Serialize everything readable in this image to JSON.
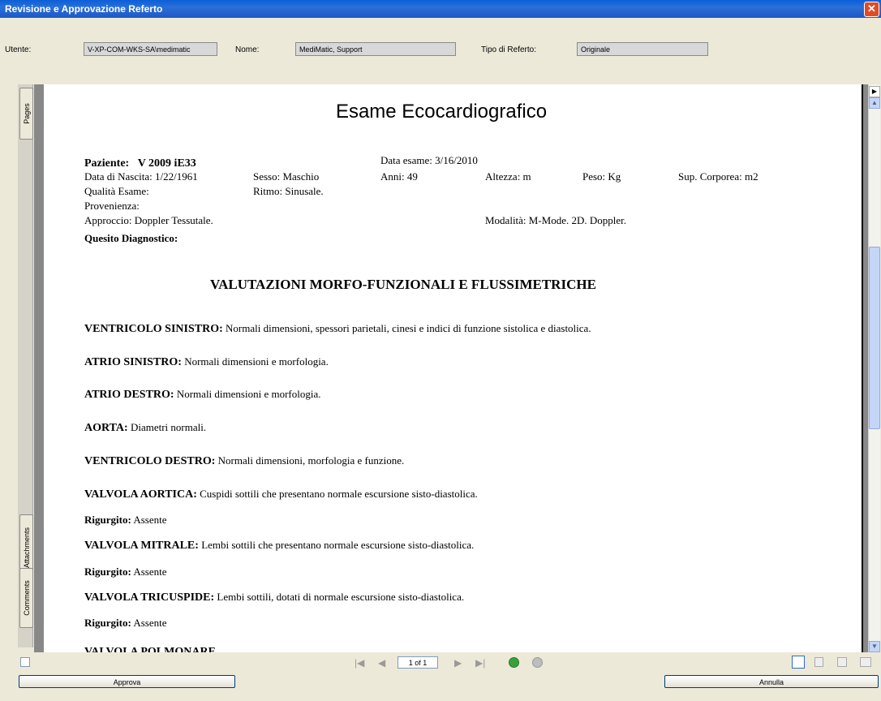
{
  "window": {
    "title": "Revisione e Approvazione Referto",
    "close_glyph": "✕"
  },
  "info": {
    "user_label": "Utente:",
    "user_value": "V-XP-COM-WKS-SA\\medimatic",
    "name_label": "Nome:",
    "name_value": "MediMatic, Support",
    "type_label": "Tipo di Referto:",
    "type_value": "Originale"
  },
  "side_tabs": {
    "pages": "Pages",
    "attachments": "Attachments",
    "comments": "Comments"
  },
  "report": {
    "title": "Esame Ecocardiografico",
    "patient_label": "Paziente:",
    "patient_value": "V 2009 iE33",
    "exam_date": "Data esame: 3/16/2010",
    "birth": "Data di Nascita: 1/22/1961",
    "sex": "Sesso: Maschio",
    "age": "Anni: 49",
    "height": "Altezza: m",
    "weight": "Peso: Kg",
    "bsa": "Sup. Corporea: m2",
    "quality": "Qualità Esame:",
    "rhythm": "Ritmo: Sinusale.",
    "origin": "Provenienza:",
    "approach": "Approccio: Doppler Tessutale.",
    "modality": "Modalità: M-Mode. 2D. Doppler.",
    "question": "Quesito Diagnostico:",
    "section_title": "VALUTAZIONI MORFO-FUNZIONALI E FLUSSIMETRICHE",
    "findings": [
      {
        "k": "VENTRICOLO SINISTRO:",
        "v": "Normali dimensioni, spessori parietali, cinesi e indici di funzione sistolica e diastolica."
      },
      {
        "k": "ATRIO SINISTRO:",
        "v": "Normali dimensioni e morfologia."
      },
      {
        "k": "ATRIO DESTRO:",
        "v": "Normali dimensioni e morfologia."
      },
      {
        "k": "AORTA:",
        "v": "Diametri normali."
      },
      {
        "k": "VENTRICOLO DESTRO:",
        "v": "Normali dimensioni, morfologia e funzione."
      },
      {
        "k": "VALVOLA AORTICA:",
        "v": "Cuspidi sottili che presentano normale escursione sisto-diastolica."
      },
      {
        "k": "Rigurgito:",
        "v": "Assente"
      },
      {
        "k": "VALVOLA MITRALE:",
        "v": "Lembi sottili che presentano normale escursione sisto-diastolica."
      },
      {
        "k": "Rigurgito:",
        "v": "Assente"
      },
      {
        "k": "VALVOLA TRICUSPIDE:",
        "v": "Lembi sottili, dotati di normale escursione sisto-diastolica."
      },
      {
        "k": "Rigurgito:",
        "v": "Assente"
      },
      {
        "k": "VALVOLA POLMONARE",
        "v": ""
      }
    ]
  },
  "nav": {
    "page_indicator": "1 of 1"
  },
  "buttons": {
    "approve": "Approva",
    "cancel": "Annulla"
  }
}
